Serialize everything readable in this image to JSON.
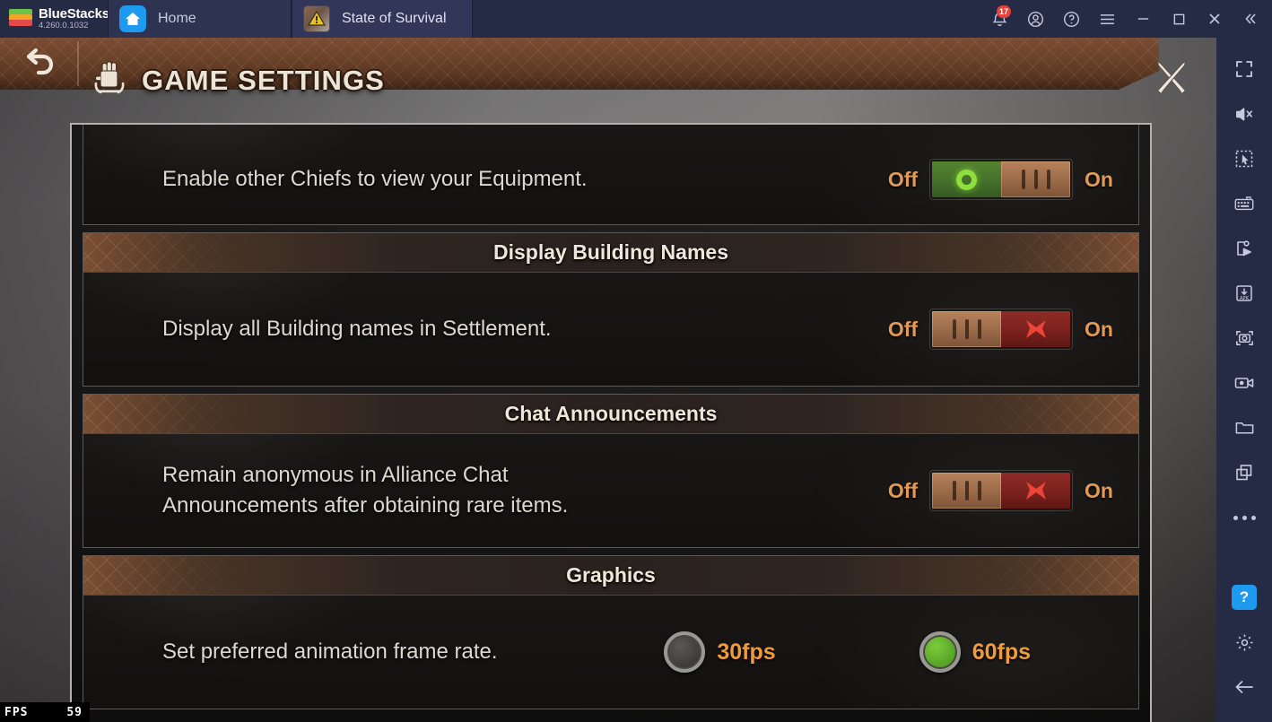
{
  "titlebar": {
    "brand_name": "BlueStacks",
    "version": "4.260.0.1032",
    "tabs": [
      {
        "label": "Home",
        "icon": "home-icon",
        "active": false
      },
      {
        "label": "State of Survival",
        "icon": "game-app-icon",
        "active": true
      }
    ],
    "system_icons": [
      {
        "name": "notifications-bell-icon",
        "badge": "17"
      },
      {
        "name": "account-icon",
        "badge": ""
      },
      {
        "name": "help-circle-icon",
        "badge": ""
      },
      {
        "name": "hamburger-menu-icon",
        "badge": ""
      },
      {
        "name": "minimize-icon",
        "badge": ""
      },
      {
        "name": "maximize-icon",
        "badge": ""
      },
      {
        "name": "close-icon",
        "badge": ""
      },
      {
        "name": "collapse-left-icon",
        "badge": ""
      }
    ]
  },
  "game": {
    "header": {
      "title": "GAME SETTINGS",
      "back_icon": "back-arrow-icon",
      "crest_icon": "fist-crest-icon",
      "close_icon": "close-x-icon"
    },
    "settings": [
      {
        "type": "toggle_row",
        "label": "Enable other Chiefs to view your Equipment.",
        "off_label": "Off",
        "on_label": "On",
        "state": "on"
      },
      {
        "type": "section",
        "title": "Display Building Names",
        "rows": [
          {
            "type": "toggle_row",
            "label": "Display all Building names in Settlement.",
            "off_label": "Off",
            "on_label": "On",
            "state": "off"
          }
        ]
      },
      {
        "type": "section",
        "title": "Chat Announcements",
        "rows": [
          {
            "type": "toggle_row",
            "label_line1": "Remain anonymous in Alliance Chat",
            "label_line2": "Announcements after obtaining rare items.",
            "off_label": "Off",
            "on_label": "On",
            "state": "off"
          }
        ]
      },
      {
        "type": "section",
        "title": "Graphics",
        "rows": [
          {
            "type": "radio_row",
            "label": "Set preferred animation frame rate.",
            "options": [
              {
                "label": "30fps",
                "selected": false
              },
              {
                "label": "60fps",
                "selected": true
              }
            ]
          }
        ]
      }
    ],
    "fps_counter": {
      "label": "FPS",
      "value": "59"
    }
  },
  "sidebar": {
    "items": [
      {
        "name": "fullscreen-icon"
      },
      {
        "name": "mute-icon"
      },
      {
        "name": "cursor-select-icon"
      },
      {
        "name": "keyboard-controls-icon"
      },
      {
        "name": "macro-script-icon"
      },
      {
        "name": "install-apk-icon"
      },
      {
        "name": "screenshot-icon"
      },
      {
        "name": "screen-record-icon"
      },
      {
        "name": "media-folder-icon"
      },
      {
        "name": "multi-instance-icon"
      },
      {
        "name": "more-options-icon"
      }
    ],
    "bottom_items": [
      {
        "name": "help-button-icon",
        "label": "?"
      },
      {
        "name": "settings-gear-icon"
      },
      {
        "name": "back-arrow-icon"
      }
    ]
  },
  "colors": {
    "accent_blue": "#1e9bf0",
    "titlebar_bg": "#262b45",
    "banner_brown": "#6a4129",
    "toggle_on_green": "#44702a",
    "toggle_off_red": "#7b211d",
    "label_orange": "#e09a56",
    "radio_green": "#4d9a22"
  }
}
